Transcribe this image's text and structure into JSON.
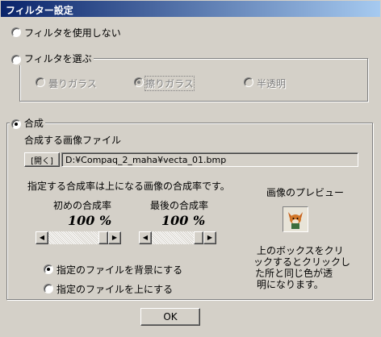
{
  "window": {
    "title": "フィルター設定"
  },
  "filter_mode": {
    "no_filter_label": "フィルタを使用しない",
    "choose_filter_label": "フィルタを選ぶ",
    "options": [
      {
        "label": "曇りガラス"
      },
      {
        "label": "擦りガラス"
      },
      {
        "label": "半透明"
      }
    ]
  },
  "composite": {
    "label": "合成",
    "file_label": "合成する画像ファイル",
    "browse_label": "[開く]",
    "file_path": "D:¥Compaq_2_maha¥vecta_01.bmp",
    "rate_desc": "指定する合成率は上になる画像の合成率です。",
    "initial_label": "初めの合成率",
    "final_label": "最後の合成率",
    "initial_value": "100 %",
    "final_value": "100 %",
    "initial_slider_level": 1.0,
    "final_slider_level": 1.0,
    "preview_label": "画像のプレビュー",
    "preview_hint": [
      "上のボックスをクリ",
      "ックするとクリックし",
      "た所と同じ色が透",
      "明になります。"
    ],
    "bg_option_label": "指定のファイルを背景にする",
    "top_option_label": "指定のファイルを上にする"
  },
  "footer": {
    "ok_label": "OK"
  }
}
